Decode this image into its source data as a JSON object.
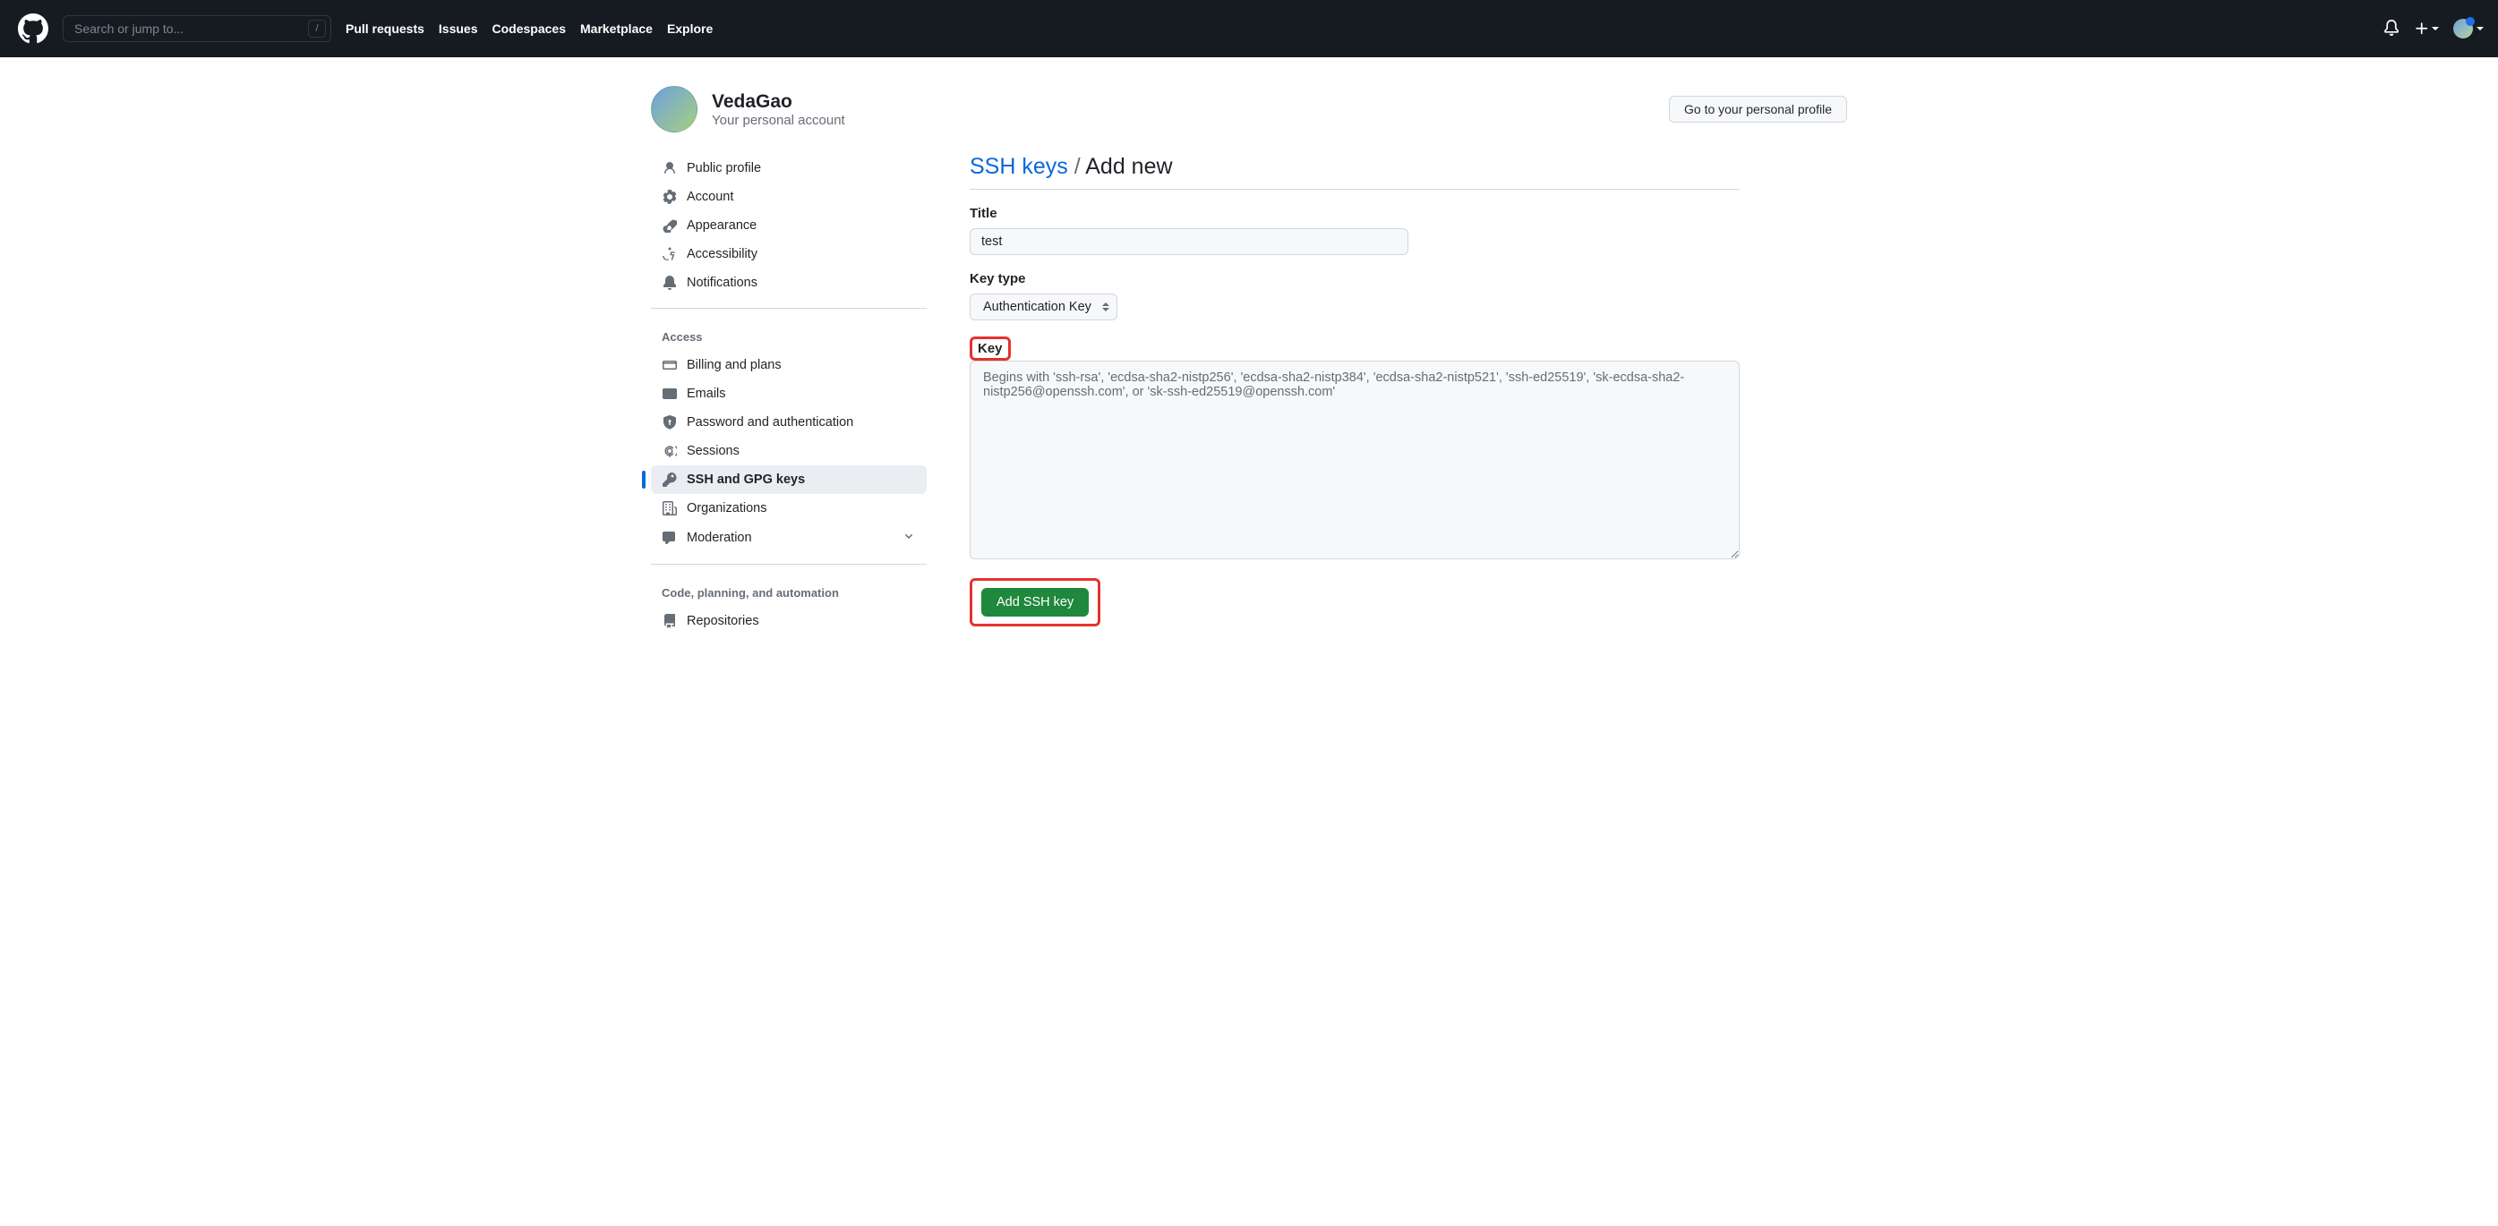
{
  "search": {
    "placeholder": "Search or jump to...",
    "slash": "/"
  },
  "topnav": {
    "pull_requests": "Pull requests",
    "issues": "Issues",
    "codespaces": "Codespaces",
    "marketplace": "Marketplace",
    "explore": "Explore"
  },
  "profile": {
    "name": "VedaGao",
    "sub": "Your personal account",
    "button": "Go to your personal profile"
  },
  "sidebar": {
    "group1": {
      "public_profile": "Public profile",
      "account": "Account",
      "appearance": "Appearance",
      "accessibility": "Accessibility",
      "notifications": "Notifications"
    },
    "access": {
      "title": "Access",
      "billing": "Billing and plans",
      "emails": "Emails",
      "password": "Password and authentication",
      "sessions": "Sessions",
      "ssh": "SSH and GPG keys",
      "orgs": "Organizations",
      "moderation": "Moderation"
    },
    "code": {
      "title": "Code, planning, and automation",
      "repositories": "Repositories"
    }
  },
  "breadcrumb": {
    "link": "SSH keys",
    "sep": "/",
    "current": "Add new"
  },
  "form": {
    "title_label": "Title",
    "title_value": "test",
    "keytype_label": "Key type",
    "keytype_value": "Authentication Key",
    "key_label": "Key",
    "key_placeholder": "Begins with 'ssh-rsa', 'ecdsa-sha2-nistp256', 'ecdsa-sha2-nistp384', 'ecdsa-sha2-nistp521', 'ssh-ed25519', 'sk-ecdsa-sha2-nistp256@openssh.com', or 'sk-ssh-ed25519@openssh.com'",
    "submit": "Add SSH key"
  }
}
